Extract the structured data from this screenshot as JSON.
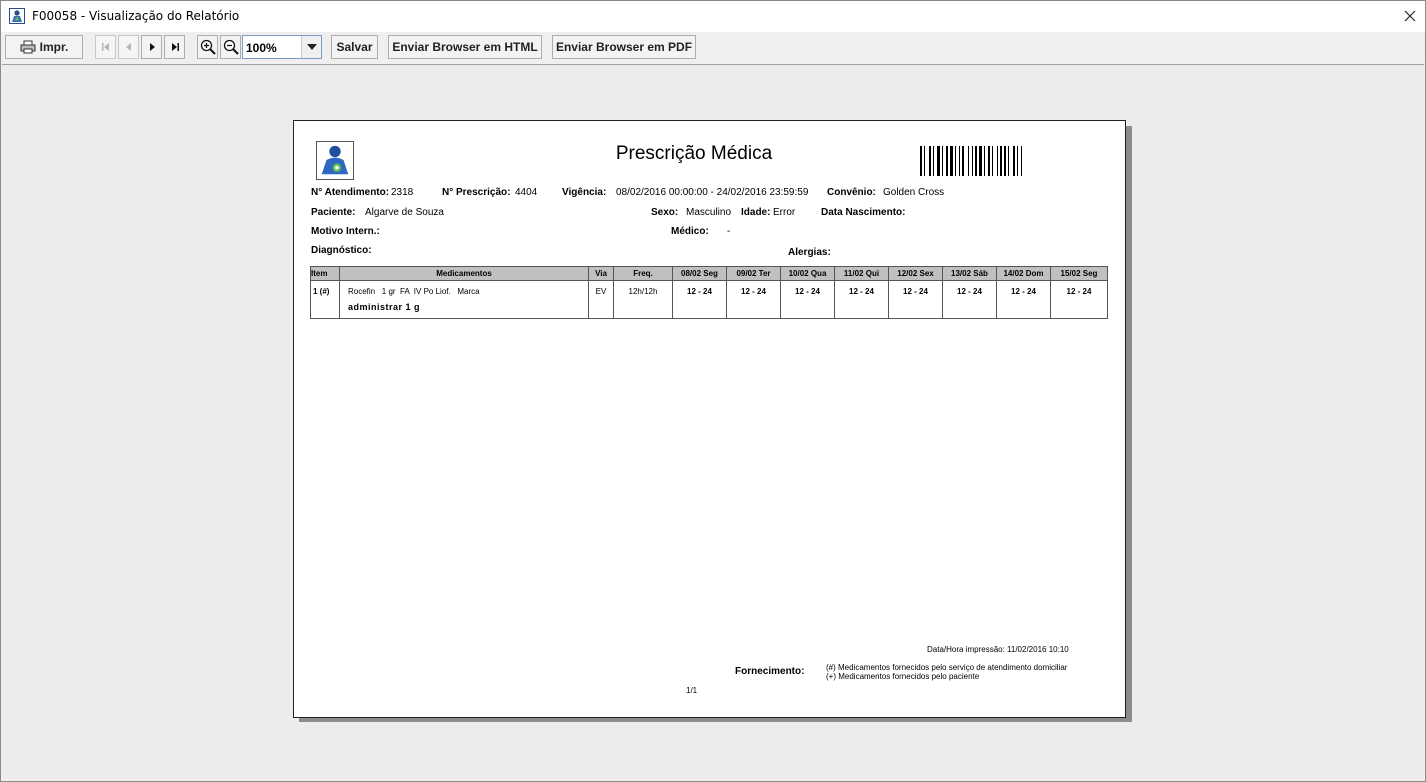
{
  "window": {
    "title": "F00058 - Visualização do Relatório"
  },
  "toolbar": {
    "print_label": "Impr.",
    "zoom_value": "100%",
    "save_label": "Salvar",
    "send_html_label": "Enviar Browser em HTML",
    "send_pdf_label": "Enviar Browser em PDF"
  },
  "report": {
    "title": "Prescrição Médica",
    "atendimento_label": "N° Atendimento:",
    "atendimento_value": "2318",
    "prescricao_label": "N° Prescrição:",
    "prescricao_value": "4404",
    "vigencia_label": "Vigência:",
    "vigencia_value": "08/02/2016 00:00:00 - 24/02/2016 23:59:59",
    "convenio_label": "Convênio:",
    "convenio_value": "Golden Cross",
    "paciente_label": "Paciente:",
    "paciente_value": "Algarve de Souza",
    "sexo_label": "Sexo:",
    "sexo_value": "Masculino",
    "idade_label": "Idade:",
    "idade_value": "Error",
    "nascimento_label": "Data Nascimento:",
    "motivo_label": "Motivo Intern.:",
    "medico_label": "Médico:",
    "medico_value": "-",
    "diagnostico_label": "Diagnóstico:",
    "alergias_label": "Alergias:",
    "table": {
      "headers": [
        "Item",
        "Medicamentos",
        "Via",
        "Freq.",
        "08/02 Seg",
        "09/02 Ter",
        "10/02 Qua",
        "11/02 Qui",
        "12/02 Sex",
        "13/02 Sáb",
        "14/02 Dom",
        "15/02 Seg"
      ],
      "row": {
        "item": "1 (#)",
        "medication": "Rocefin   1 gr  FA  IV Po Liof.   Marca",
        "instruction": "administrar 1 g",
        "via": "EV",
        "freq": "12h/12h",
        "schedule": [
          "12 - 24",
          "12 - 24",
          "12 - 24",
          "12 - 24",
          "12 - 24",
          "12 - 24",
          "12 - 24",
          "12 - 24"
        ]
      }
    },
    "print_datetime": "Data/Hora impressão: 11/02/2016 10:10",
    "fornecimento_label": "Fornecimento:",
    "fornecimento_note1": "(#) Medicamentos fornecidos pelo serviço de atendimento domiciliar",
    "fornecimento_note2": "(+) Medicamentos fornecidos pelo paciente",
    "page_number": "1/1"
  }
}
